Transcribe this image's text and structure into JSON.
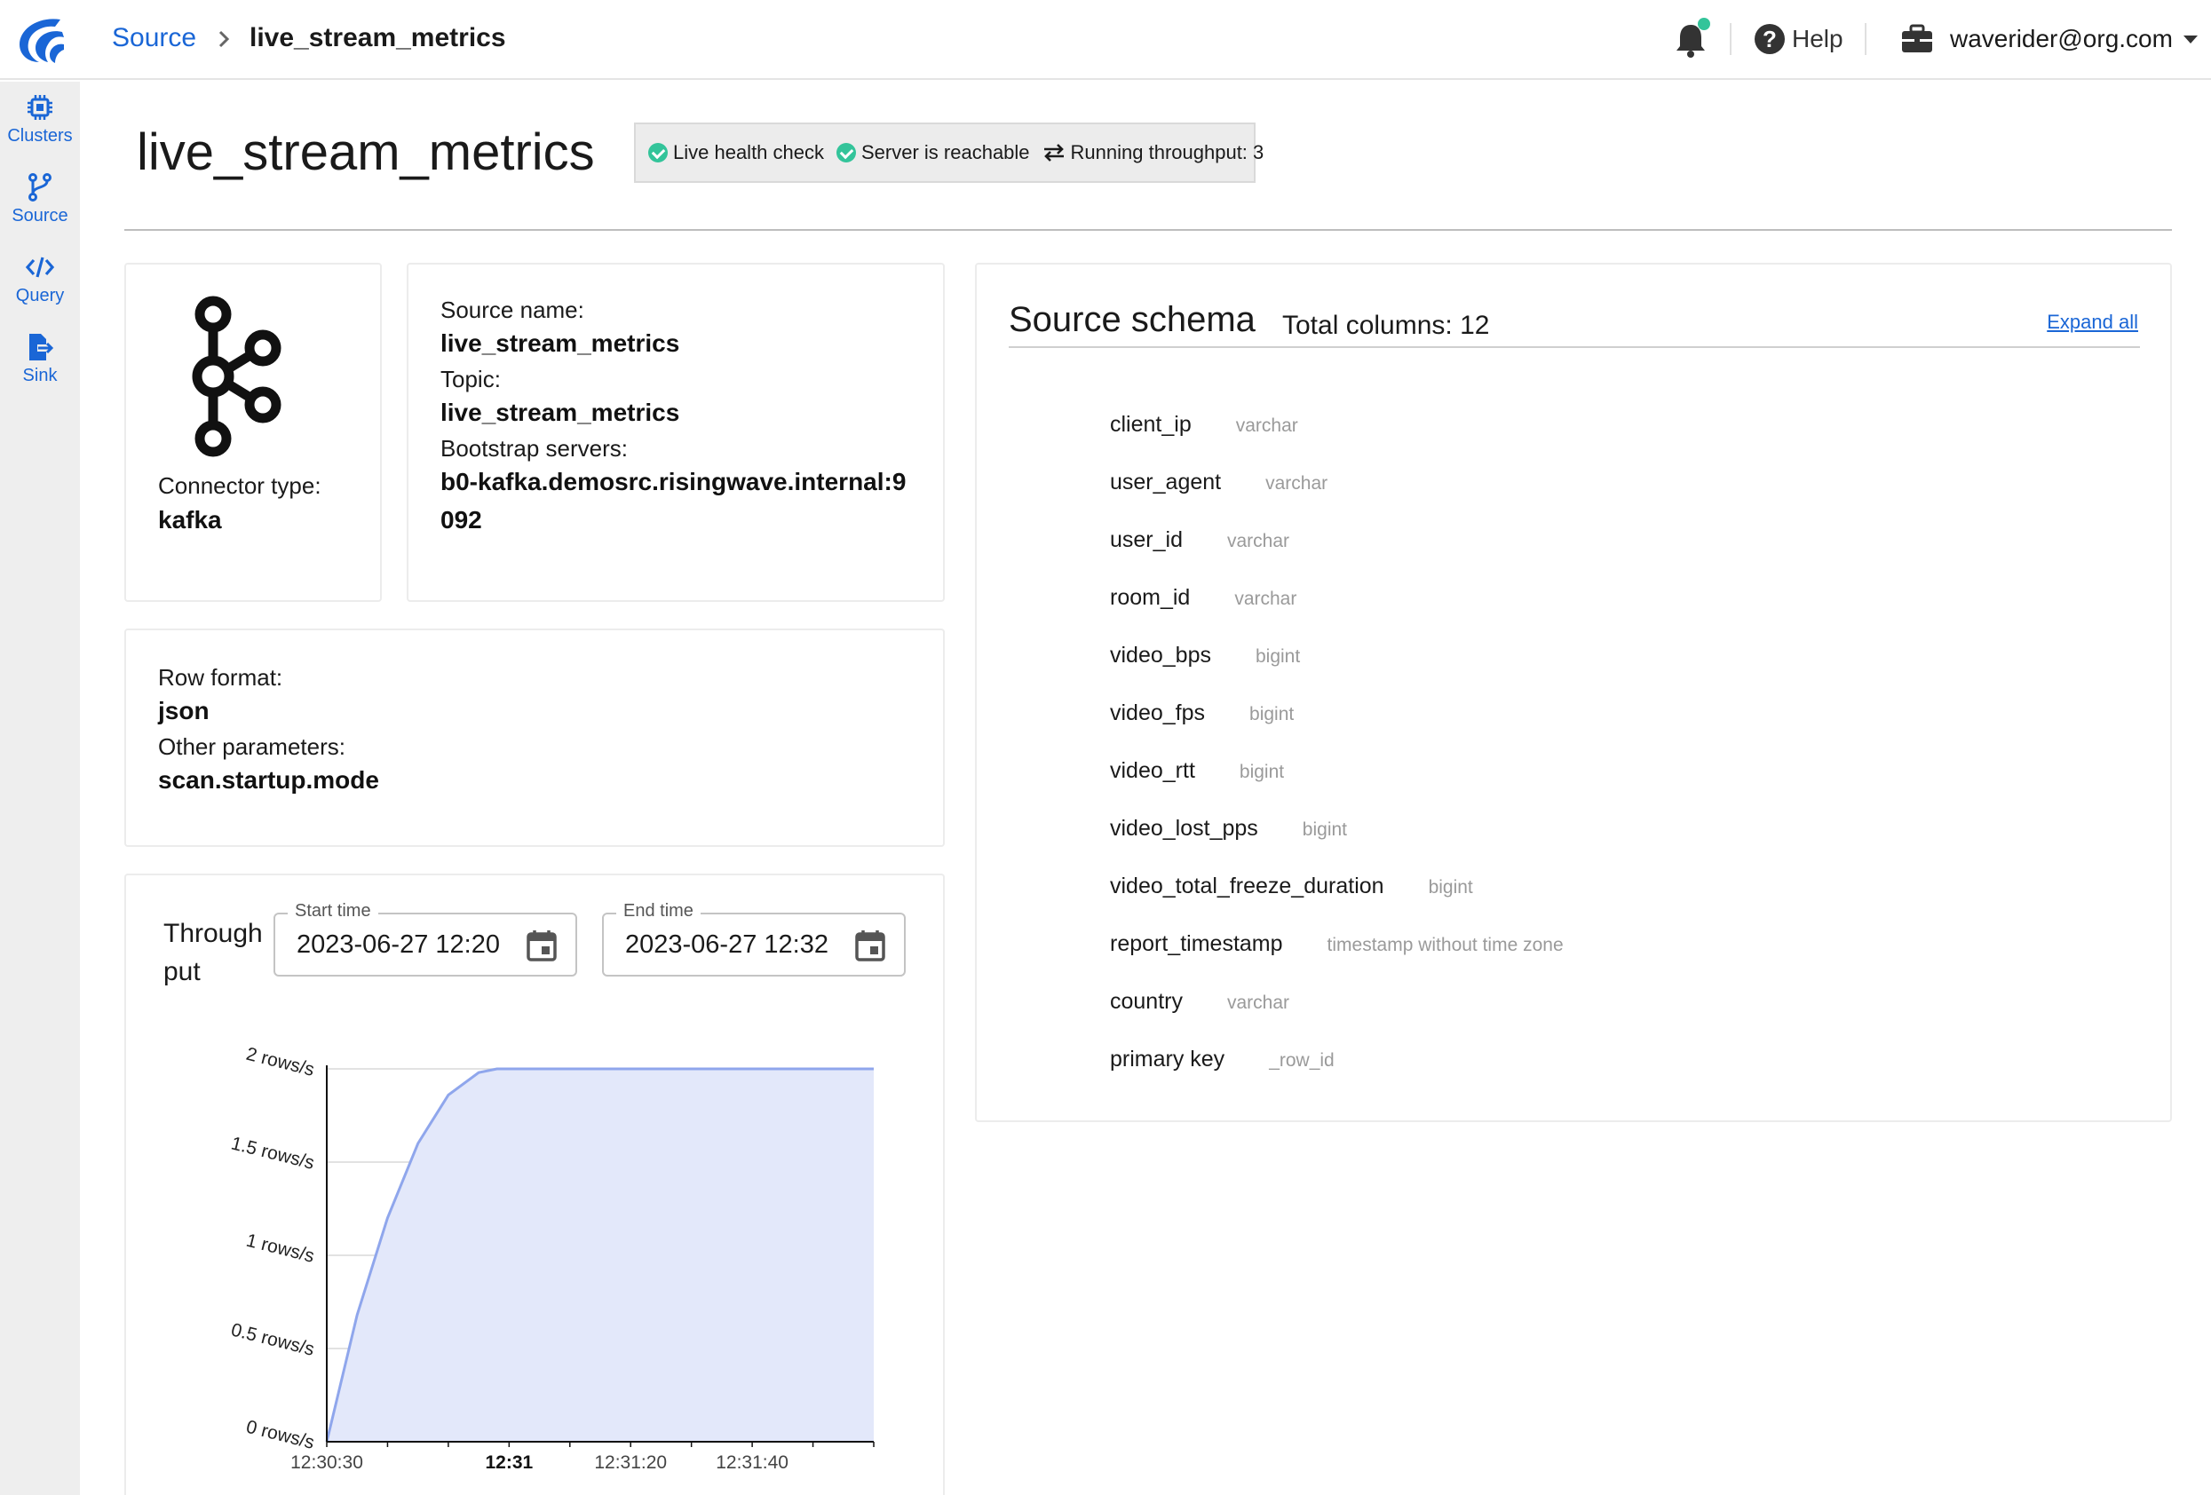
{
  "header": {
    "breadcrumb_root": "Source",
    "breadcrumb_current": "live_stream_metrics",
    "help_label": "Help",
    "account_email": "waverider@org.com"
  },
  "sidebar": {
    "items": [
      {
        "label": "Clusters",
        "icon": "chip-icon"
      },
      {
        "label": "Source",
        "icon": "branch-icon"
      },
      {
        "label": "Query",
        "icon": "code-icon"
      },
      {
        "label": "Sink",
        "icon": "file-export-icon"
      }
    ]
  },
  "page": {
    "title": "live_stream_metrics",
    "status": {
      "health": "Live health check",
      "reachable": "Server is reachable",
      "throughput": "Running throughput: 3"
    }
  },
  "connector": {
    "type_label": "Connector type:",
    "type_value": "kafka"
  },
  "source_info": {
    "name_label": "Source name:",
    "name_value": "live_stream_metrics",
    "topic_label": "Topic:",
    "topic_value": "live_stream_metrics",
    "bootstrap_label": "Bootstrap servers:",
    "bootstrap_value_line1": "b0-kafka.demosrc.risingwave.internal:9",
    "bootstrap_value_line2": "092"
  },
  "format": {
    "row_format_label": "Row format:",
    "row_format_value": "json",
    "other_params_label": "Other parameters:",
    "other_params_value": "scan.startup.mode"
  },
  "throughput": {
    "title_line1": "Through",
    "title_line2": "put",
    "start_label": "Start time",
    "start_value": "2023-06-27 12:20",
    "end_label": "End time",
    "end_value": "2023-06-27 12:32"
  },
  "schema": {
    "title": "Source schema",
    "total": "Total columns: 12",
    "expand_all": "Expand all",
    "columns": [
      {
        "name": "client_ip",
        "type": "varchar"
      },
      {
        "name": "user_agent",
        "type": "varchar"
      },
      {
        "name": "user_id",
        "type": "varchar"
      },
      {
        "name": "room_id",
        "type": "varchar"
      },
      {
        "name": "video_bps",
        "type": "bigint"
      },
      {
        "name": "video_fps",
        "type": "bigint"
      },
      {
        "name": "video_rtt",
        "type": "bigint"
      },
      {
        "name": "video_lost_pps",
        "type": "bigint"
      },
      {
        "name": "video_total_freeze_duration",
        "type": "bigint"
      },
      {
        "name": "report_timestamp",
        "type": "timestamp without time zone"
      },
      {
        "name": "country",
        "type": "varchar"
      },
      {
        "name": "primary key",
        "type": "_row_id"
      }
    ]
  },
  "colors": {
    "accent": "#1a66d6",
    "status_green": "#33c49a",
    "series_line": "#8fa6ec",
    "series_fill": "#e3e8fa"
  },
  "chart_data": {
    "type": "area",
    "ylim": [
      0,
      2
    ],
    "y_ticks": [
      "0 rows/s",
      "0.5 rows/s",
      "1 rows/s",
      "1.5 rows/s",
      "2 rows/s"
    ],
    "y_tick_values": [
      0,
      0.5,
      1,
      1.5,
      2
    ],
    "x_ticks": [
      "12:30:30",
      "12:31",
      "12:31:20",
      "12:31:40"
    ],
    "x_tick_seconds": [
      30,
      60,
      80,
      100
    ],
    "x_range_seconds": [
      30,
      120
    ],
    "series": [
      {
        "x_seconds": [
          30,
          35,
          40,
          45,
          50,
          55,
          58,
          60,
          70,
          80,
          90,
          100,
          110,
          120
        ],
        "values": [
          0,
          0.68,
          1.2,
          1.6,
          1.86,
          1.98,
          2,
          2,
          2,
          2,
          2,
          2,
          2,
          2
        ]
      }
    ]
  }
}
